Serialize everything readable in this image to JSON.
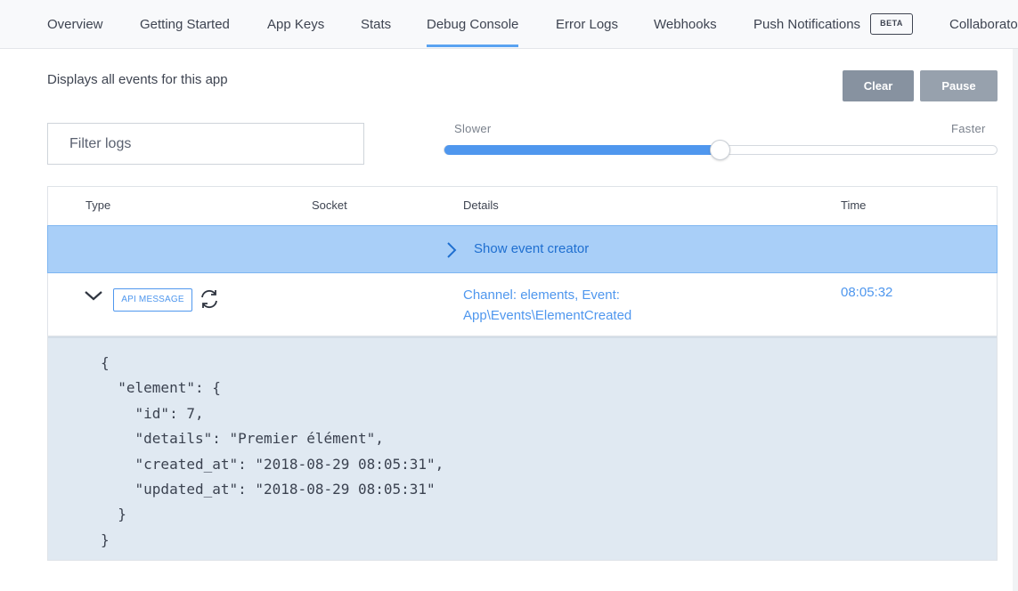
{
  "tabs": [
    {
      "label": "Overview"
    },
    {
      "label": "Getting Started"
    },
    {
      "label": "App Keys"
    },
    {
      "label": "Stats"
    },
    {
      "label": "Debug Console",
      "active": true
    },
    {
      "label": "Error Logs"
    },
    {
      "label": "Webhooks"
    },
    {
      "label": "Push Notifications",
      "badge": "BETA"
    },
    {
      "label": "Collaborators"
    }
  ],
  "page": {
    "description": "Displays all events for this app"
  },
  "toolbar": {
    "clear_label": "Clear",
    "pause_label": "Pause"
  },
  "filter": {
    "placeholder": "Filter logs",
    "value": ""
  },
  "speed_slider": {
    "min_label": "Slower",
    "max_label": "Faster",
    "level": 0.5
  },
  "table": {
    "columns": [
      "Type",
      "Socket",
      "Details",
      "Time"
    ],
    "event_creator_label": "Show event creator",
    "rows": [
      {
        "type_badge": "API MESSAGE",
        "socket": "",
        "details_line1": "Channel: elements, Event:",
        "details_line2": "App\\Events\\ElementCreated",
        "time": "08:05:32",
        "expanded": true,
        "payload": "{\n  \"element\": {\n    \"id\": 7,\n    \"details\": \"Premier élément\",\n    \"created_at\": \"2018-08-29 08:05:31\",\n    \"updated_at\": \"2018-08-29 08:05:31\"\n  }\n}"
      }
    ]
  },
  "colors": {
    "accent": "#4f97ee",
    "event_creator_bg": "#a9cff8",
    "payload_bg": "#e0e9f2",
    "button_bg": "#8792a0"
  },
  "icons": {
    "event_creator_chevron": "chevron-right-icon",
    "row_toggle": "chevron-down-icon",
    "replay": "replay-icon"
  }
}
